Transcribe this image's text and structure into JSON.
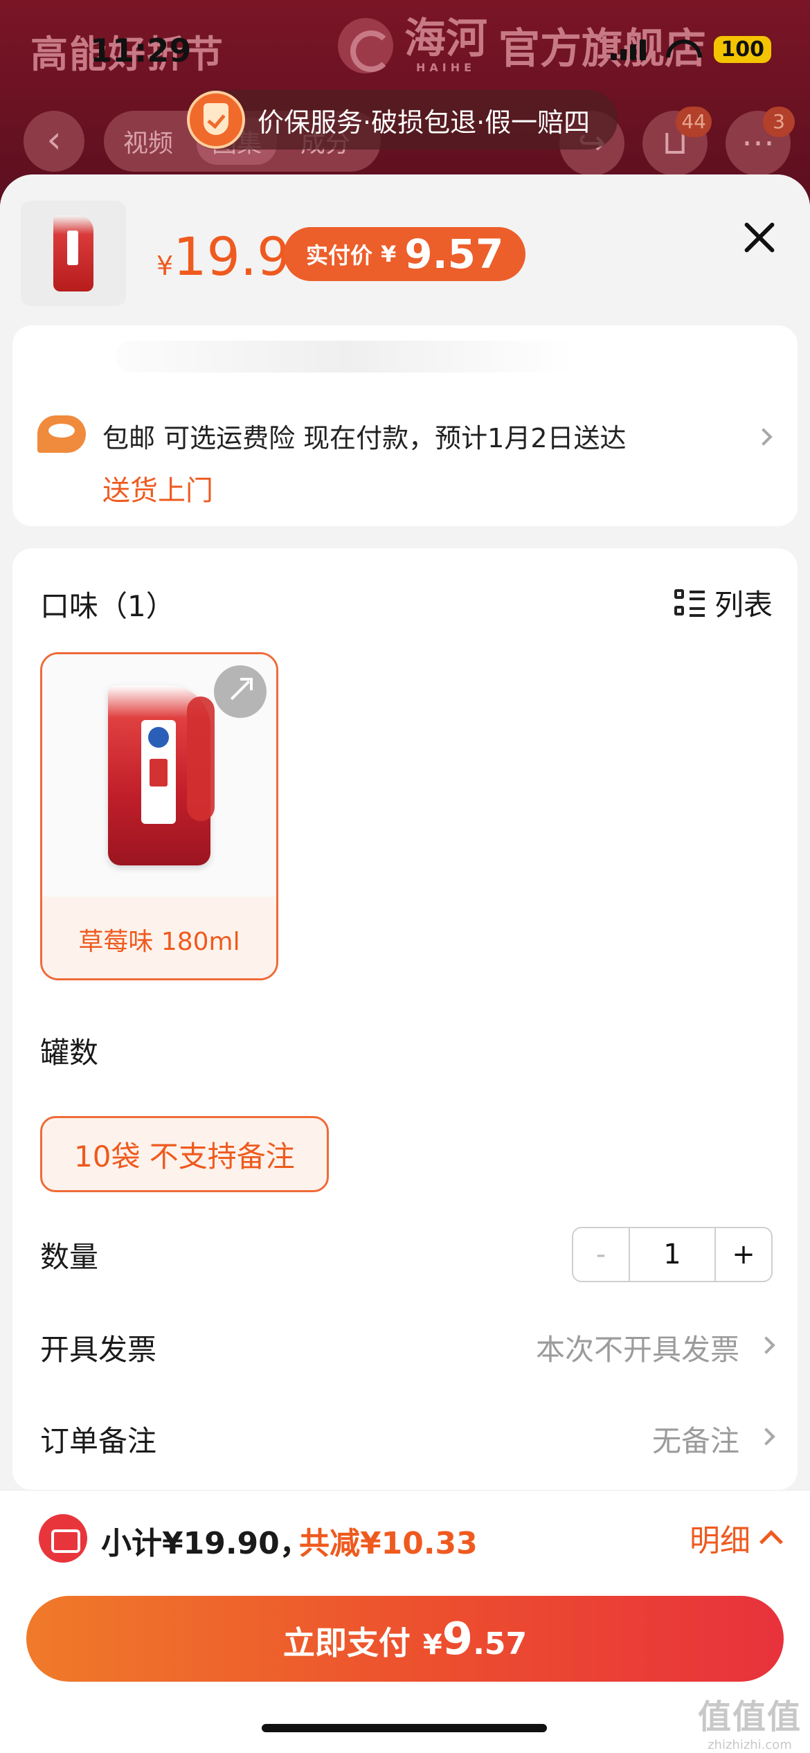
{
  "status_bar": {
    "time": "11:29",
    "battery": "100"
  },
  "store_header": {
    "banner_text": "高能好折节",
    "brand_cn": "海河",
    "brand_en": "HAIHE",
    "store_suffix": "官方旗舰店",
    "tabs": [
      "视频",
      "图集",
      "成分"
    ],
    "cart_badge": "44",
    "more_badge": "3"
  },
  "guarantee": {
    "text": "价保服务·破损包退·假一赔四"
  },
  "product": {
    "currency": "¥",
    "price": "19.9",
    "actual_label": "实付价",
    "actual_price": "9.57"
  },
  "shipping": {
    "text": "包邮 可选运费险 现在付款，预计1月2日送达",
    "sub": "送货上门"
  },
  "flavor": {
    "title": "口味（1）",
    "list_toggle": "列表",
    "options": [
      {
        "label": "草莓味 180ml",
        "selected": true
      }
    ]
  },
  "cans": {
    "title": "罐数",
    "options": [
      {
        "label": "10袋 不支持备注",
        "selected": true
      }
    ]
  },
  "quantity": {
    "label": "数量",
    "minus": "-",
    "value": "1",
    "plus": "+"
  },
  "invoice": {
    "label": "开具发票",
    "value": "本次不开具发票"
  },
  "remark": {
    "label": "订单备注",
    "value": "无备注"
  },
  "footer": {
    "subtotal": "小计¥19.90，",
    "discount": "共减¥10.33",
    "detail": "明细",
    "pay_label": "立即支付",
    "pay_currency": "¥",
    "pay_int": "9",
    "pay_dec": ".57"
  },
  "watermark": {
    "cn": "值值值",
    "en": "zhizhizhi.com"
  },
  "colors": {
    "accent": "#ef5a1f",
    "pay_gradient_start": "#f07a2a",
    "pay_gradient_end": "#e8323c",
    "header_bg": "#7a1526"
  }
}
